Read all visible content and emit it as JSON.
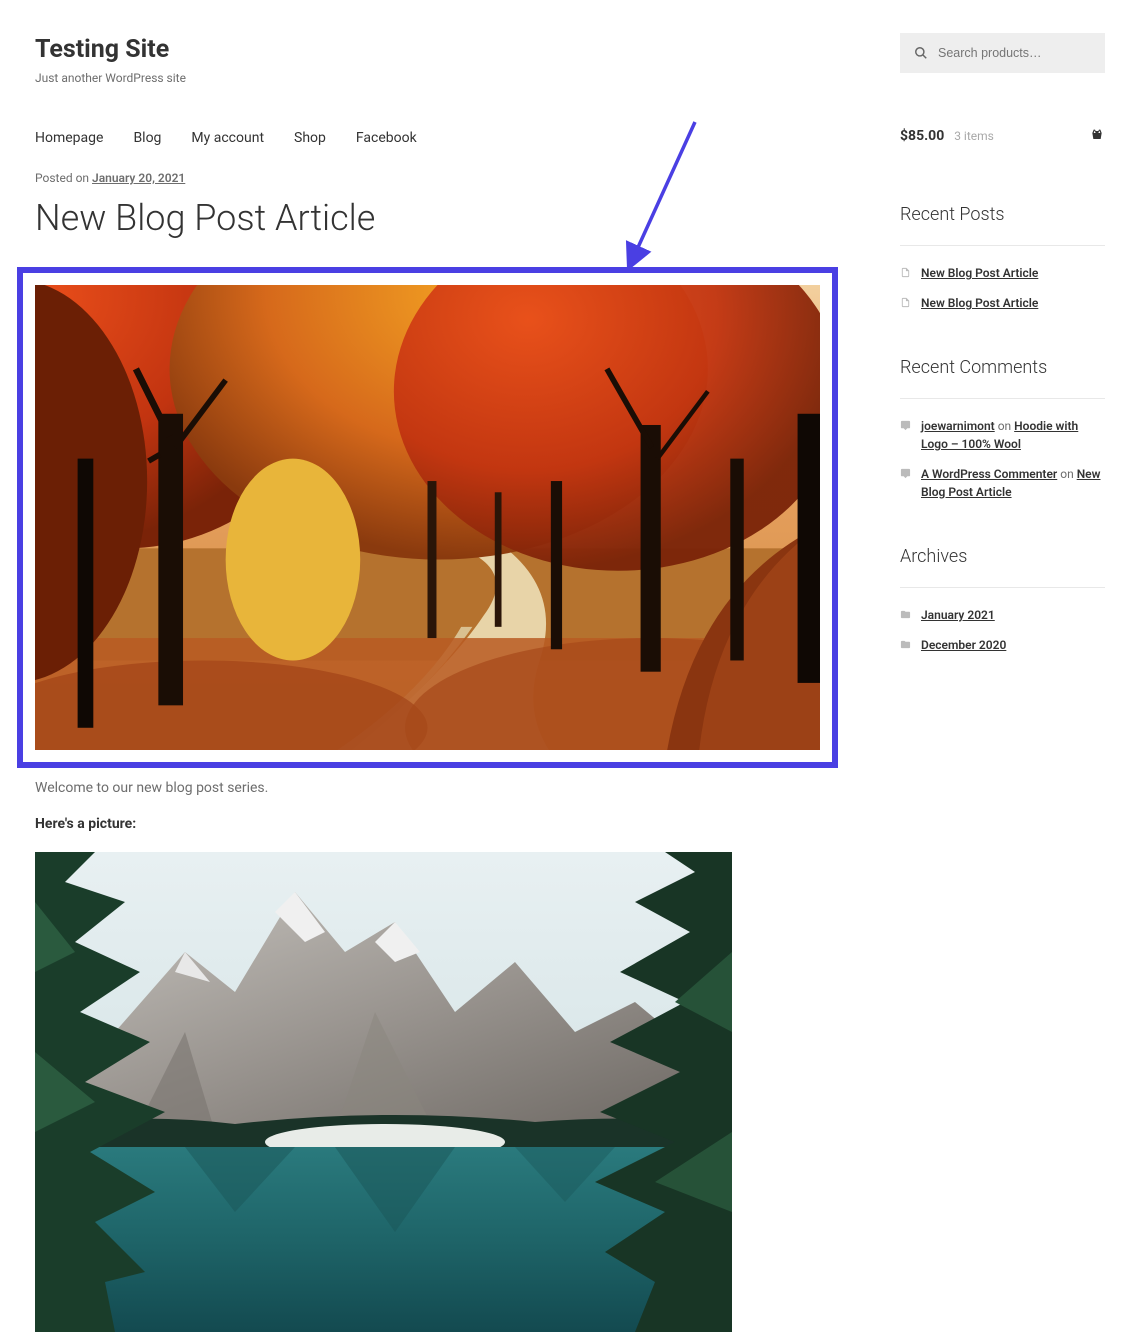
{
  "header": {
    "site_title": "Testing Site",
    "tagline": "Just another WordPress site"
  },
  "nav": {
    "items": [
      "Homepage",
      "Blog",
      "My account",
      "Shop",
      "Facebook"
    ]
  },
  "post": {
    "meta_prefix": "Posted on ",
    "date": "January 20, 2021",
    "title": "New Blog Post Article",
    "welcome": "Welcome to our new blog post series.",
    "picture_label": "Here's a picture:"
  },
  "search": {
    "placeholder": "Search products…"
  },
  "cart": {
    "price": "$85.00",
    "items": "3 items"
  },
  "widgets": {
    "recent_posts": {
      "title": "Recent Posts",
      "items": [
        "New Blog Post Article",
        "New Blog Post Article"
      ]
    },
    "recent_comments": {
      "title": "Recent Comments",
      "items": [
        {
          "author": "joewarnimont",
          "on": " on ",
          "post": "Hoodie with Logo – 100% Wool"
        },
        {
          "author": "A WordPress Commenter",
          "on": " on ",
          "post": "New Blog Post Article"
        }
      ]
    },
    "archives": {
      "title": "Archives",
      "items": [
        "January 2021",
        "December 2020"
      ]
    }
  }
}
